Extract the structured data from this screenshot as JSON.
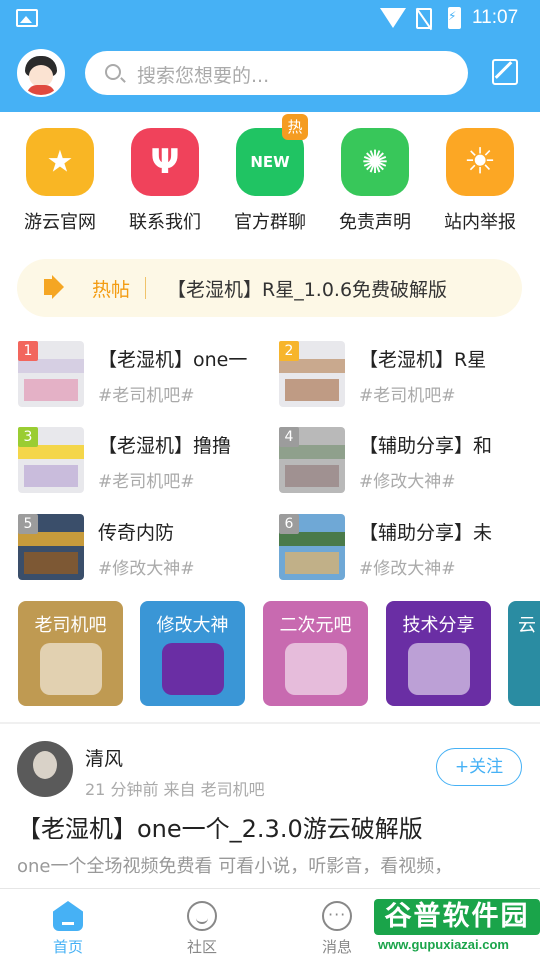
{
  "status_bar": {
    "time": "11:07"
  },
  "header": {
    "search_placeholder": "搜索您想要的..."
  },
  "quick_links": [
    {
      "label": "游云官网",
      "color": "#f9b624",
      "icon": "star-badge-icon",
      "glyph": "★"
    },
    {
      "label": "联系我们",
      "color": "#f0425b",
      "icon": "fork-knife-icon",
      "glyph": "Ψ"
    },
    {
      "label": "官方群聊",
      "color": "#20c463",
      "icon": "new-badge-icon",
      "glyph": "NEW",
      "badge": "热"
    },
    {
      "label": "免责声明",
      "color": "#38c75a",
      "icon": "kiwi-icon",
      "glyph": "✺"
    },
    {
      "label": "站内举报",
      "color": "#fca724",
      "icon": "sun-icon",
      "glyph": "☀"
    }
  ],
  "hot_post": {
    "label": "热帖",
    "text": "【老湿机】R星_1.0.6免费破解版"
  },
  "ranking": [
    {
      "rank": "1",
      "title": "【老湿机】one一",
      "tag": "#老司机吧#",
      "rank_color": "#f2665d"
    },
    {
      "rank": "2",
      "title": "【老湿机】R星",
      "tag": "#老司机吧#",
      "rank_color": "#f7b52c"
    },
    {
      "rank": "3",
      "title": "【老湿机】撸撸",
      "tag": "#老司机吧#",
      "rank_color": "#9acd32"
    },
    {
      "rank": "4",
      "title": "【辅助分享】和",
      "tag": "#修改大神#",
      "rank_color": "#9c9c9c"
    },
    {
      "rank": "5",
      "title": "传奇内防",
      "tag": "#修改大神#",
      "rank_color": "#9c9c9c"
    },
    {
      "rank": "6",
      "title": "【辅助分享】未",
      "tag": "#修改大神#",
      "rank_color": "#9c9c9c"
    }
  ],
  "categories": [
    {
      "label": "老司机吧",
      "color": "#bf9a52"
    },
    {
      "label": "修改大神",
      "color": "#3a96d6"
    },
    {
      "label": "二次元吧",
      "color": "#c86ab0"
    },
    {
      "label": "技术分享",
      "color": "#6a2ea4"
    },
    {
      "label": "云",
      "color": "#2a8ca2"
    }
  ],
  "post": {
    "author": "清风",
    "meta": "21 分钟前  来自 老司机吧",
    "follow_label": "+关注",
    "title": "【老湿机】one一个_2.3.0游云破解版",
    "excerpt": "one一个全场视频免费看 可看小说，听影音，看视频，"
  },
  "bottom_nav": [
    {
      "label": "首页",
      "icon": "home-icon",
      "active": true
    },
    {
      "label": "社区",
      "icon": "community-icon",
      "active": false
    },
    {
      "label": "消息",
      "icon": "message-icon",
      "active": false
    }
  ],
  "watermark": {
    "title": "谷普软件园",
    "url": "www.gupuxiazai.com"
  }
}
